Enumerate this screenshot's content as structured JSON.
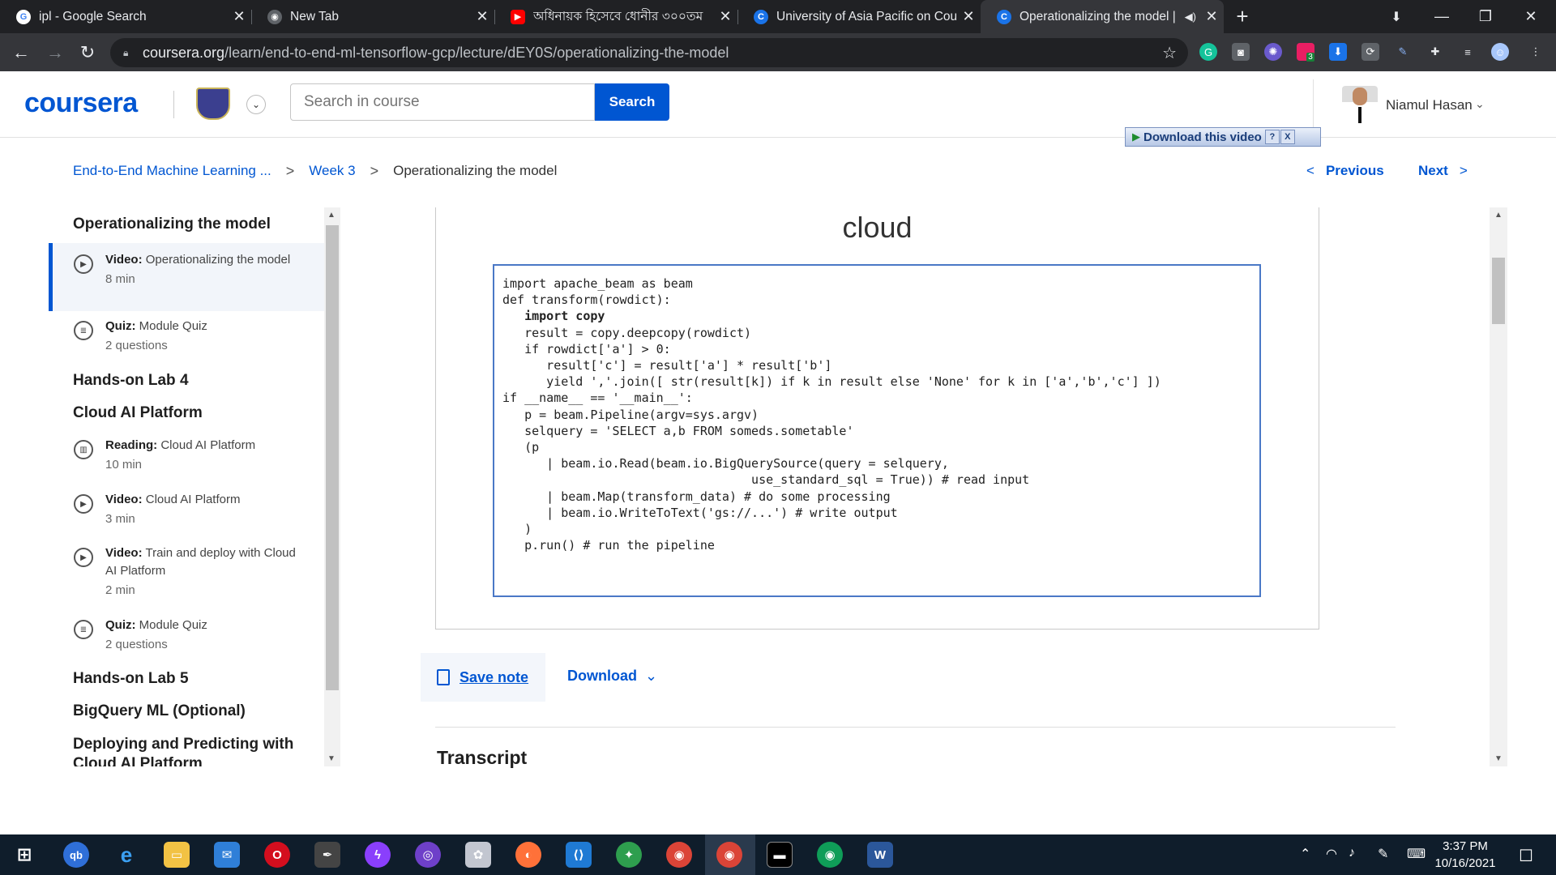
{
  "browser": {
    "tabs": [
      {
        "title": "ipl - Google Search",
        "icon": "google-icon",
        "color": "#4285f4"
      },
      {
        "title": "New Tab",
        "icon": "chrome-icon",
        "color": "#5f6368"
      },
      {
        "title": "অধিনায়ক হিসেবে ধোনীর ৩০০তম",
        "icon": "youtube-icon",
        "color": "#ff0000"
      },
      {
        "title": "University of Asia Pacific on Cour",
        "icon": "coursera-icon",
        "color": "#1a73e8"
      },
      {
        "title": "Operationalizing the model |",
        "icon": "coursera-icon",
        "color": "#1a73e8"
      }
    ],
    "new_tab": "+",
    "url_host": "coursera.org",
    "url_path": "/learn/end-to-end-ml-tensorflow-gcp/lecture/dEY0S/operationalizing-the-model",
    "extension_badge": "3"
  },
  "header": {
    "logo": "coursera",
    "search_placeholder": "Search in course",
    "search_button": "Search",
    "user_name": "Niamul Hasan",
    "download_video": "Download this video",
    "download_video_help": "?",
    "download_video_close": "X"
  },
  "breadcrumb": {
    "course": "End-to-End Machine Learning ...",
    "week": "Week 3",
    "current": "Operationalizing the model",
    "separator": ">",
    "previous": "Previous",
    "next": "Next"
  },
  "sidebar": {
    "title": "Operationalizing the model",
    "items": [
      {
        "kind": "Video:",
        "name": "Operationalizing the model",
        "duration": "8 min",
        "icon": "play-circle-icon",
        "current": true
      },
      {
        "kind": "Quiz:",
        "name": "Module Quiz",
        "duration": "2 questions",
        "icon": "quiz-icon"
      },
      {
        "kind": "Reading:",
        "name": "Cloud AI Platform",
        "duration": "10 min",
        "icon": "book-icon"
      },
      {
        "kind": "Video:",
        "name": "Cloud AI Platform",
        "duration": "3 min",
        "icon": "play-circle-icon"
      },
      {
        "kind": "Video:",
        "name": "Train and deploy with Cloud AI Platform",
        "duration": "2 min",
        "icon": "play-circle-icon"
      },
      {
        "kind": "Quiz:",
        "name": "Module Quiz",
        "duration": "2 questions",
        "icon": "quiz-icon"
      }
    ],
    "headings": [
      "Hands-on Lab 4",
      "Cloud AI Platform",
      "Hands-on Lab 5",
      "BigQuery ML (Optional)",
      "Deploying and Predicting with Cloud AI Platform"
    ]
  },
  "main": {
    "slide_title": "cloud",
    "code_lines": [
      "import apache_beam as beam",
      "",
      "def transform(rowdict):",
      "   import copy",
      "   result = copy.deepcopy(rowdict)",
      "   if rowdict['a'] > 0:",
      "      result['c'] = result['a'] * result['b']",
      "      yield ','.join([ str(result[k]) if k in result else 'None' for k in ['a','b','c'] ])",
      "",
      "if __name__ == '__main__':",
      "   p = beam.Pipeline(argv=sys.argv)",
      "   selquery = 'SELECT a,b FROM someds.sometable'",
      "   (p",
      "      | beam.io.Read(beam.io.BigQuerySource(query = selquery,",
      "                                  use_standard_sql = True)) # read input",
      "      | beam.Map(transform_data) # do some processing",
      "      | beam.io.WriteToText('gs://...') # write output",
      "   )",
      "   p.run() # run the pipeline"
    ],
    "save_note": "Save note",
    "download": "Download",
    "transcript": "Transcript"
  },
  "taskbar": {
    "time": "3:37 PM",
    "date": "10/16/2021",
    "icons": [
      "windows-start-icon",
      "qbittorrent-icon",
      "edge-icon",
      "file-explorer-icon",
      "mail-icon",
      "opera-icon",
      "inkscape-icon",
      "messenger-icon",
      "github-desktop-icon",
      "krita-icon",
      "firefox-icon",
      "vscode-icon",
      "app-icon",
      "chrome-icon",
      "chrome-active-icon",
      "terminal-icon",
      "chrome-profile-icon",
      "word-icon"
    ],
    "qb_label": "qb"
  },
  "colors": {
    "accent": "#0056d2",
    "chrome_bg": "#202124",
    "taskbar_bg": "#0f1d2b"
  }
}
